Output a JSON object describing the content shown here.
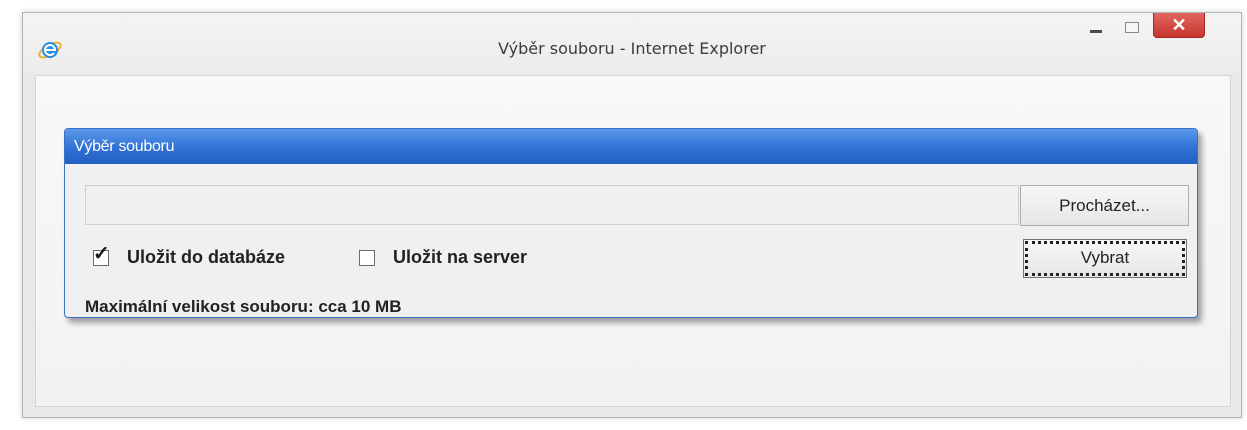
{
  "window": {
    "title": "Výběr souboru - Internet Explorer",
    "close_symbol": "✕"
  },
  "icons": {
    "app": "internet-explorer-icon",
    "minimize": "minimize-icon",
    "maximize": "maximize-icon",
    "close": "close-icon",
    "check": "checkmark-icon"
  },
  "panel": {
    "header": "Výběr souboru",
    "file_path_value": "",
    "browse_label": "Procházet...",
    "select_label": "Vybrat",
    "options": [
      {
        "label": "Uložit do databáze",
        "checked": true
      },
      {
        "label": "Uložit na server",
        "checked": false
      }
    ],
    "max_size_text": "Maximální velikost souboru: cca 10 MB"
  },
  "colors": {
    "panel_header": "#2f70d6",
    "panel_border": "#3a72c8",
    "close_button": "#c6352d"
  }
}
